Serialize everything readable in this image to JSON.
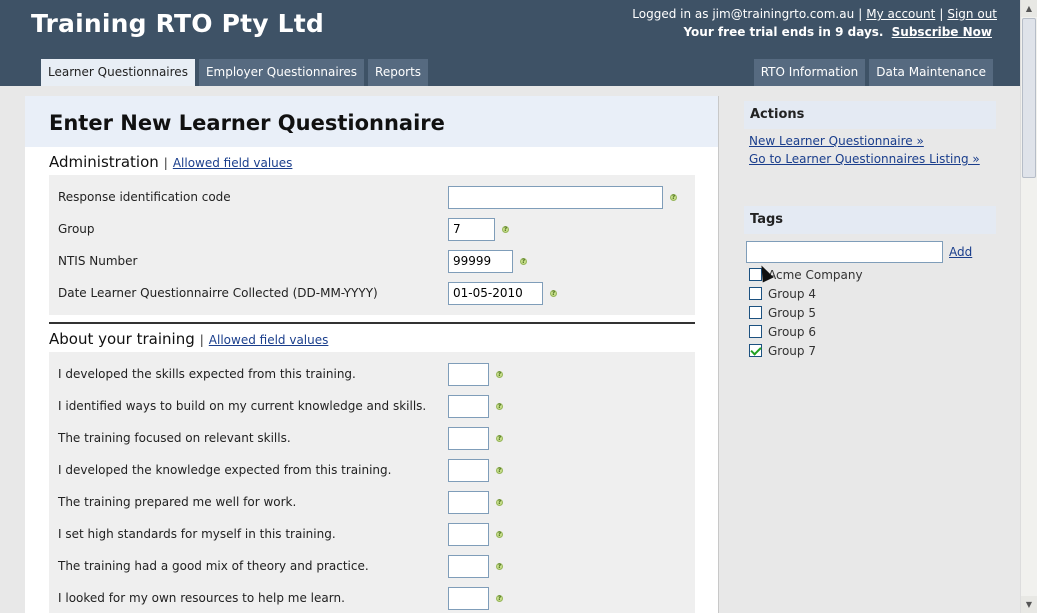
{
  "header": {
    "brand": "Training RTO Pty Ltd",
    "logged_in_prefix": "Logged in as",
    "user_email": "jim@trainingrto.com.au",
    "my_account": "My account",
    "sign_out": "Sign out",
    "trial_text": "Your free trial ends in 9 days.",
    "subscribe": "Subscribe Now"
  },
  "tabs_left": [
    {
      "label": "Learner Questionnaires",
      "active": true
    },
    {
      "label": "Employer Questionnaires",
      "active": false
    },
    {
      "label": "Reports",
      "active": false
    }
  ],
  "tabs_right": [
    {
      "label": "RTO Information"
    },
    {
      "label": "Data Maintenance"
    }
  ],
  "main": {
    "title": "Enter New Learner Questionnaire",
    "admin": {
      "title": "Administration",
      "link": "Allowed field values",
      "fields": [
        {
          "label": "Response identification code",
          "value": ""
        },
        {
          "label": "Group",
          "value": "7"
        },
        {
          "label": "NTIS Number",
          "value": "99999"
        },
        {
          "label": "Date Learner Questionnairre Collected (DD-MM-YYYY)",
          "value": "01-05-2010"
        }
      ]
    },
    "training": {
      "title": "About your training",
      "link": "Allowed field values",
      "questions": [
        {
          "label": "I developed the skills expected from this training.",
          "value": ""
        },
        {
          "label": "I identified ways to build on my current knowledge and skills.",
          "value": ""
        },
        {
          "label": "The training focused on relevant skills.",
          "value": ""
        },
        {
          "label": "I developed the knowledge expected from this training.",
          "value": ""
        },
        {
          "label": "The training prepared me well for work.",
          "value": ""
        },
        {
          "label": "I set high standards for myself in this training.",
          "value": ""
        },
        {
          "label": "The training had a good mix of theory and practice.",
          "value": ""
        },
        {
          "label": "I looked for my own resources to help me learn.",
          "value": ""
        }
      ]
    }
  },
  "sidebar": {
    "actions_title": "Actions",
    "actions": [
      {
        "label": "New Learner Questionnaire »"
      },
      {
        "label": "Go to Learner Questionnaires Listing »"
      }
    ],
    "tags_title": "Tags",
    "tag_input_value": "",
    "add_label": "Add",
    "tags": [
      {
        "label": "Acme Company",
        "checked": false
      },
      {
        "label": "Group 4",
        "checked": false
      },
      {
        "label": "Group 5",
        "checked": false
      },
      {
        "label": "Group 6",
        "checked": false
      },
      {
        "label": "Group 7",
        "checked": true
      }
    ]
  },
  "colors": {
    "header_bg": "#3e5266",
    "tab_bg": "#566a80",
    "link": "#1a3e8c"
  }
}
